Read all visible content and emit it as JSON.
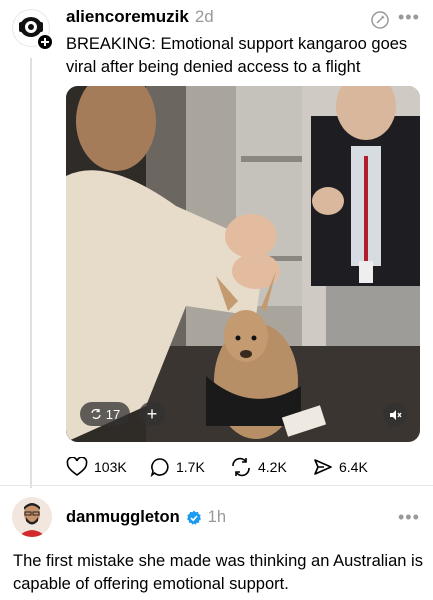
{
  "post": {
    "username": "aliencoremuzik",
    "time": "2d",
    "text": "BREAKING: Emotional support kangaroo goes viral after being denied access to a flight",
    "video": {
      "repost_count": "17",
      "add_label": "+"
    },
    "actions": {
      "likes": "103K",
      "comments": "1.7K",
      "reposts": "4.2K",
      "shares": "6.4K"
    }
  },
  "reply": {
    "username": "danmuggleton",
    "time": "1h",
    "text": "The first mistake she made was thinking an Australian is capable of offering emotional support."
  },
  "icons": {
    "avatar_badge": "plus-icon",
    "edit": "edit-circle-icon",
    "mute": "mute-icon",
    "like": "heart-icon",
    "comment": "comment-icon",
    "repost": "repost-icon",
    "share": "share-icon",
    "verified": "verified-badge-icon"
  },
  "colors": {
    "verified": "#1d9bf0",
    "muted_text": "#999999"
  }
}
